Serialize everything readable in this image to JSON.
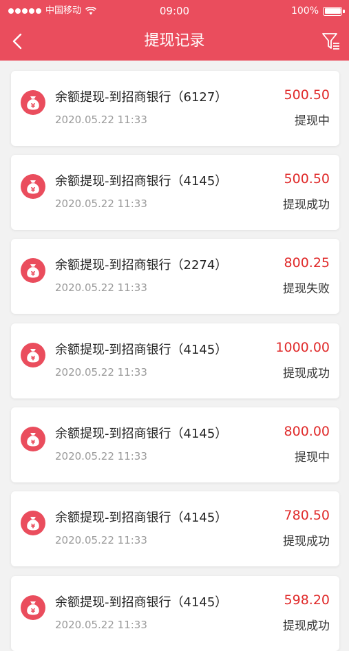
{
  "status_bar": {
    "carrier": "中国移动",
    "time": "09:00",
    "battery": "100%"
  },
  "header": {
    "title": "提现记录",
    "back_icon": "chevron-left-icon",
    "filter_icon": "filter-icon"
  },
  "colors": {
    "accent": "#ea4d5d",
    "amount": "#e02a2a"
  },
  "records": [
    {
      "name": "余额提现-到招商银行（6127）",
      "date": "2020.05.22 11:33",
      "amount": "500.50",
      "status": "提现中"
    },
    {
      "name": "余额提现-到招商银行（4145）",
      "date": "2020.05.22 11:33",
      "amount": "500.50",
      "status": "提现成功"
    },
    {
      "name": "余额提现-到招商银行（2274）",
      "date": "2020.05.22 11:33",
      "amount": "800.25",
      "status": "提现失败"
    },
    {
      "name": "余额提现-到招商银行（4145）",
      "date": "2020.05.22 11:33",
      "amount": "1000.00",
      "status": "提现成功"
    },
    {
      "name": "余额提现-到招商银行（4145）",
      "date": "2020.05.22 11:33",
      "amount": "800.00",
      "status": "提现中"
    },
    {
      "name": "余额提现-到招商银行（4145）",
      "date": "2020.05.22 11:33",
      "amount": "780.50",
      "status": "提现成功"
    },
    {
      "name": "余额提现-到招商银行（4145）",
      "date": "2020.05.22 11:33",
      "amount": "598.20",
      "status": "提现成功"
    }
  ]
}
